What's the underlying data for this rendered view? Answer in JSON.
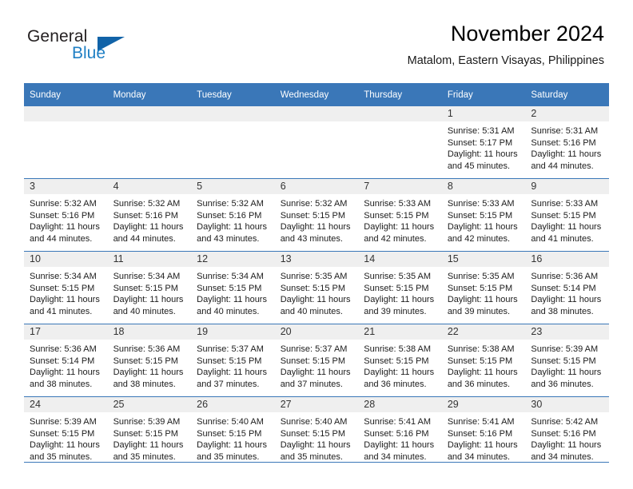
{
  "logo": {
    "word_top": "General",
    "word_bottom": "Blue",
    "triangle_color": "#1163a8",
    "blue_color": "#1f7fc4"
  },
  "header": {
    "title": "November 2024",
    "subtitle": "Matalom, Eastern Visayas, Philippines"
  },
  "theme": {
    "header_blue": "#3a77b8",
    "daynum_bg": "#efefef",
    "text": "#1c1c1c"
  },
  "weekday_headers": [
    "Sunday",
    "Monday",
    "Tuesday",
    "Wednesday",
    "Thursday",
    "Friday",
    "Saturday"
  ],
  "labels": {
    "sunrise_prefix": "Sunrise:",
    "sunset_prefix": "Sunset:",
    "daylight_prefix": "Daylight:"
  },
  "weeks": [
    [
      {
        "empty": true
      },
      {
        "empty": true
      },
      {
        "empty": true
      },
      {
        "empty": true
      },
      {
        "empty": true
      },
      {
        "day": "1",
        "sunrise": "Sunrise: 5:31 AM",
        "sunset": "Sunset: 5:17 PM",
        "daylight1": "Daylight: 11 hours",
        "daylight2": "and 45 minutes."
      },
      {
        "day": "2",
        "sunrise": "Sunrise: 5:31 AM",
        "sunset": "Sunset: 5:16 PM",
        "daylight1": "Daylight: 11 hours",
        "daylight2": "and 44 minutes."
      }
    ],
    [
      {
        "day": "3",
        "sunrise": "Sunrise: 5:32 AM",
        "sunset": "Sunset: 5:16 PM",
        "daylight1": "Daylight: 11 hours",
        "daylight2": "and 44 minutes."
      },
      {
        "day": "4",
        "sunrise": "Sunrise: 5:32 AM",
        "sunset": "Sunset: 5:16 PM",
        "daylight1": "Daylight: 11 hours",
        "daylight2": "and 44 minutes."
      },
      {
        "day": "5",
        "sunrise": "Sunrise: 5:32 AM",
        "sunset": "Sunset: 5:16 PM",
        "daylight1": "Daylight: 11 hours",
        "daylight2": "and 43 minutes."
      },
      {
        "day": "6",
        "sunrise": "Sunrise: 5:32 AM",
        "sunset": "Sunset: 5:15 PM",
        "daylight1": "Daylight: 11 hours",
        "daylight2": "and 43 minutes."
      },
      {
        "day": "7",
        "sunrise": "Sunrise: 5:33 AM",
        "sunset": "Sunset: 5:15 PM",
        "daylight1": "Daylight: 11 hours",
        "daylight2": "and 42 minutes."
      },
      {
        "day": "8",
        "sunrise": "Sunrise: 5:33 AM",
        "sunset": "Sunset: 5:15 PM",
        "daylight1": "Daylight: 11 hours",
        "daylight2": "and 42 minutes."
      },
      {
        "day": "9",
        "sunrise": "Sunrise: 5:33 AM",
        "sunset": "Sunset: 5:15 PM",
        "daylight1": "Daylight: 11 hours",
        "daylight2": "and 41 minutes."
      }
    ],
    [
      {
        "day": "10",
        "sunrise": "Sunrise: 5:34 AM",
        "sunset": "Sunset: 5:15 PM",
        "daylight1": "Daylight: 11 hours",
        "daylight2": "and 41 minutes."
      },
      {
        "day": "11",
        "sunrise": "Sunrise: 5:34 AM",
        "sunset": "Sunset: 5:15 PM",
        "daylight1": "Daylight: 11 hours",
        "daylight2": "and 40 minutes."
      },
      {
        "day": "12",
        "sunrise": "Sunrise: 5:34 AM",
        "sunset": "Sunset: 5:15 PM",
        "daylight1": "Daylight: 11 hours",
        "daylight2": "and 40 minutes."
      },
      {
        "day": "13",
        "sunrise": "Sunrise: 5:35 AM",
        "sunset": "Sunset: 5:15 PM",
        "daylight1": "Daylight: 11 hours",
        "daylight2": "and 40 minutes."
      },
      {
        "day": "14",
        "sunrise": "Sunrise: 5:35 AM",
        "sunset": "Sunset: 5:15 PM",
        "daylight1": "Daylight: 11 hours",
        "daylight2": "and 39 minutes."
      },
      {
        "day": "15",
        "sunrise": "Sunrise: 5:35 AM",
        "sunset": "Sunset: 5:15 PM",
        "daylight1": "Daylight: 11 hours",
        "daylight2": "and 39 minutes."
      },
      {
        "day": "16",
        "sunrise": "Sunrise: 5:36 AM",
        "sunset": "Sunset: 5:14 PM",
        "daylight1": "Daylight: 11 hours",
        "daylight2": "and 38 minutes."
      }
    ],
    [
      {
        "day": "17",
        "sunrise": "Sunrise: 5:36 AM",
        "sunset": "Sunset: 5:14 PM",
        "daylight1": "Daylight: 11 hours",
        "daylight2": "and 38 minutes."
      },
      {
        "day": "18",
        "sunrise": "Sunrise: 5:36 AM",
        "sunset": "Sunset: 5:15 PM",
        "daylight1": "Daylight: 11 hours",
        "daylight2": "and 38 minutes."
      },
      {
        "day": "19",
        "sunrise": "Sunrise: 5:37 AM",
        "sunset": "Sunset: 5:15 PM",
        "daylight1": "Daylight: 11 hours",
        "daylight2": "and 37 minutes."
      },
      {
        "day": "20",
        "sunrise": "Sunrise: 5:37 AM",
        "sunset": "Sunset: 5:15 PM",
        "daylight1": "Daylight: 11 hours",
        "daylight2": "and 37 minutes."
      },
      {
        "day": "21",
        "sunrise": "Sunrise: 5:38 AM",
        "sunset": "Sunset: 5:15 PM",
        "daylight1": "Daylight: 11 hours",
        "daylight2": "and 36 minutes."
      },
      {
        "day": "22",
        "sunrise": "Sunrise: 5:38 AM",
        "sunset": "Sunset: 5:15 PM",
        "daylight1": "Daylight: 11 hours",
        "daylight2": "and 36 minutes."
      },
      {
        "day": "23",
        "sunrise": "Sunrise: 5:39 AM",
        "sunset": "Sunset: 5:15 PM",
        "daylight1": "Daylight: 11 hours",
        "daylight2": "and 36 minutes."
      }
    ],
    [
      {
        "day": "24",
        "sunrise": "Sunrise: 5:39 AM",
        "sunset": "Sunset: 5:15 PM",
        "daylight1": "Daylight: 11 hours",
        "daylight2": "and 35 minutes."
      },
      {
        "day": "25",
        "sunrise": "Sunrise: 5:39 AM",
        "sunset": "Sunset: 5:15 PM",
        "daylight1": "Daylight: 11 hours",
        "daylight2": "and 35 minutes."
      },
      {
        "day": "26",
        "sunrise": "Sunrise: 5:40 AM",
        "sunset": "Sunset: 5:15 PM",
        "daylight1": "Daylight: 11 hours",
        "daylight2": "and 35 minutes."
      },
      {
        "day": "27",
        "sunrise": "Sunrise: 5:40 AM",
        "sunset": "Sunset: 5:15 PM",
        "daylight1": "Daylight: 11 hours",
        "daylight2": "and 35 minutes."
      },
      {
        "day": "28",
        "sunrise": "Sunrise: 5:41 AM",
        "sunset": "Sunset: 5:16 PM",
        "daylight1": "Daylight: 11 hours",
        "daylight2": "and 34 minutes."
      },
      {
        "day": "29",
        "sunrise": "Sunrise: 5:41 AM",
        "sunset": "Sunset: 5:16 PM",
        "daylight1": "Daylight: 11 hours",
        "daylight2": "and 34 minutes."
      },
      {
        "day": "30",
        "sunrise": "Sunrise: 5:42 AM",
        "sunset": "Sunset: 5:16 PM",
        "daylight1": "Daylight: 11 hours",
        "daylight2": "and 34 minutes."
      }
    ]
  ]
}
